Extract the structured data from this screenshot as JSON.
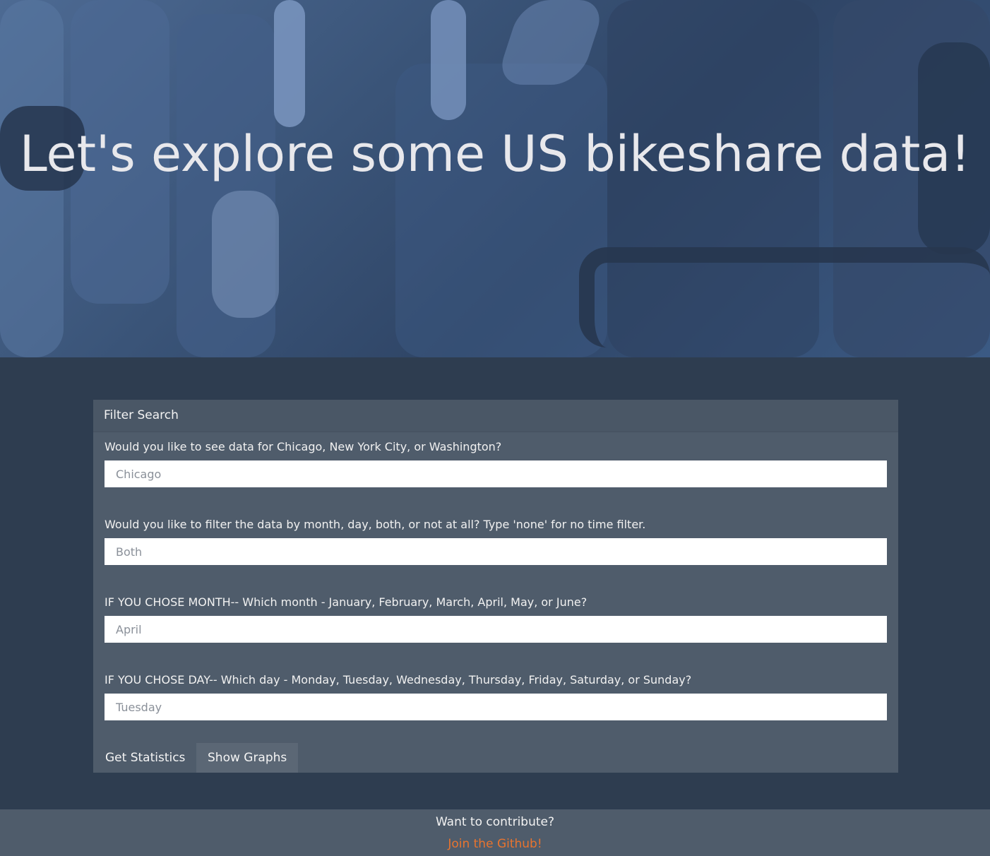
{
  "hero": {
    "title": "Let's explore some US bikeshare data!"
  },
  "panel": {
    "header": "Filter Search",
    "fields": [
      {
        "label": "Would you like to see data for Chicago, New York City, or Washington?",
        "placeholder": "Chicago"
      },
      {
        "label": "Would you like to filter the data by month, day, both, or not at all? Type 'none' for no time filter.",
        "placeholder": "Both"
      },
      {
        "label": "IF YOU CHOSE MONTH-- Which month - January, February, March, April, May, or June?",
        "placeholder": "April"
      },
      {
        "label": "IF YOU CHOSE DAY-- Which day - Monday, Tuesday, Wednesday, Thursday, Friday, Saturday, or Sunday?",
        "placeholder": "Tuesday"
      }
    ],
    "buttons": {
      "stats": "Get Statistics",
      "graphs": "Show Graphs"
    }
  },
  "footer": {
    "question": "Want to contribute?",
    "link": "Join the Github!"
  },
  "colors": {
    "background": "#2e3d50",
    "panel": "#4f5c6b",
    "link": "#e8742f"
  }
}
